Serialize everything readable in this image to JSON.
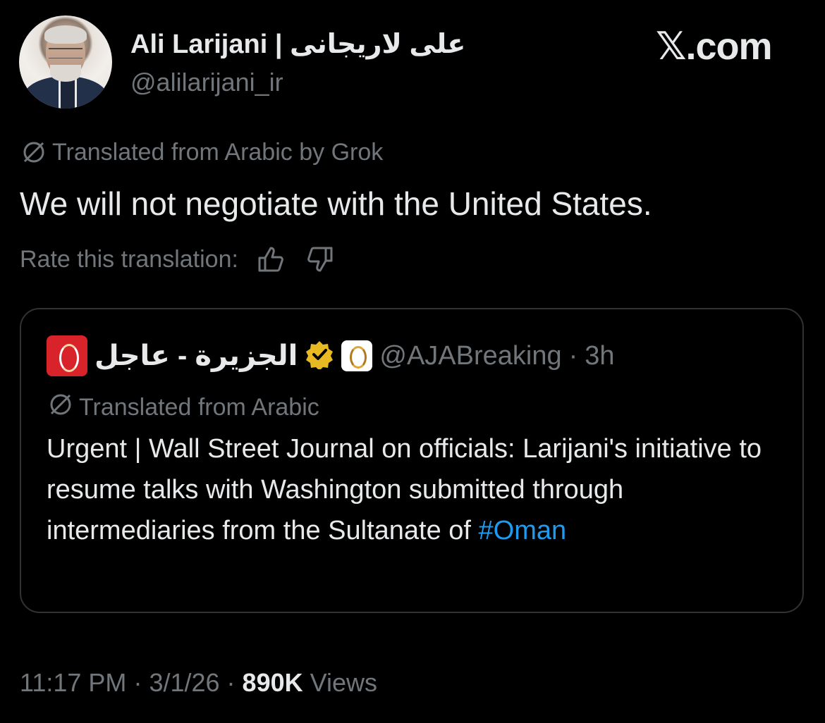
{
  "author": {
    "display_name": "Ali Larijani | علی لاریجانی",
    "handle": "@alilarijani_ir"
  },
  "brand": {
    "site": ".com"
  },
  "post": {
    "translation_note": "Translated from Arabic by Grok",
    "text": "We will not negotiate with the United States.",
    "rate_label": "Rate this translation:"
  },
  "quoted": {
    "display_name": "الجزيرة - عاجل",
    "handle": "@AJABreaking",
    "time": "3h",
    "translation_note": "Translated from Arabic",
    "text_main": "Urgent | Wall Street Journal on officials: Larijani's initiative to resume talks with Washington submitted through intermediaries from the Sultanate of ",
    "hashtag": "#Oman"
  },
  "meta": {
    "time": "11:17 PM",
    "date": "3/1/26",
    "views_count": "890K",
    "views_label": "Views"
  },
  "colors": {
    "background": "#000000",
    "text": "#e7e9ea",
    "muted": "#71767b",
    "link": "#1d9bf0",
    "border": "#2f3336",
    "verified_gold": "#e8b923"
  },
  "icons": [
    "translate-icon",
    "thumbs-up-icon",
    "thumbs-down-icon",
    "verified-badge-icon",
    "x-logo-icon"
  ]
}
